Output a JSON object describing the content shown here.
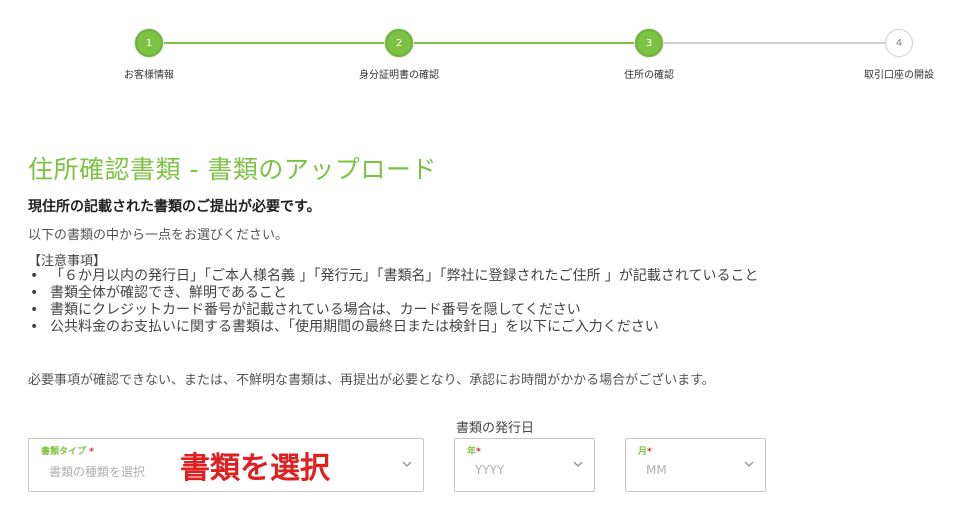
{
  "stepper": {
    "steps": [
      {
        "number": "1",
        "label": "お客様情報",
        "state": "done"
      },
      {
        "number": "2",
        "label": "身分証明書の確認",
        "state": "done"
      },
      {
        "number": "3",
        "label": "住所の確認",
        "state": "done"
      },
      {
        "number": "4",
        "label": "取引口座の開設",
        "state": "todo"
      }
    ],
    "accent_color": "#7cc243"
  },
  "main": {
    "title": "住所確認書類 - 書類のアップロード",
    "subtitle": "現住所の記載された書類のご提出が必要です。",
    "description": "以下の書類の中から一点をお選びください。",
    "notes_header": "【注意事項】",
    "notes": [
      "「６か月以内の発行日」「ご本人様名義 」「発行元」「書類名」「弊社に登録されたご住所 」が記載されていること",
      "書類全体が確認でき、鮮明であること",
      "書類にクレジットカード番号が記載されている場合は、カード番号を隠してください",
      "公共料金のお支払いに関する書類は、「使用期間の最終日または検針日」を以下にご入力ください"
    ],
    "footer_note": "必要事項が確認できない、または、不鮮明な書類は、再提出が必要となり、承認にお時間がかかる場合がございます。"
  },
  "form": {
    "document_type": {
      "label": "書類タイプ",
      "required_mark": "*",
      "placeholder": "書類の種類を選択",
      "icon": "chevron-down-icon"
    },
    "issue_date_label": "書類の発行日",
    "year": {
      "label": "年",
      "required_mark": "*",
      "placeholder": "YYYY",
      "icon": "chevron-down-icon"
    },
    "month": {
      "label": "月",
      "required_mark": "*",
      "placeholder": "MM",
      "icon": "chevron-down-icon"
    },
    "overlay_annotation": "書類を選択",
    "annotation_color": "#e02020"
  }
}
